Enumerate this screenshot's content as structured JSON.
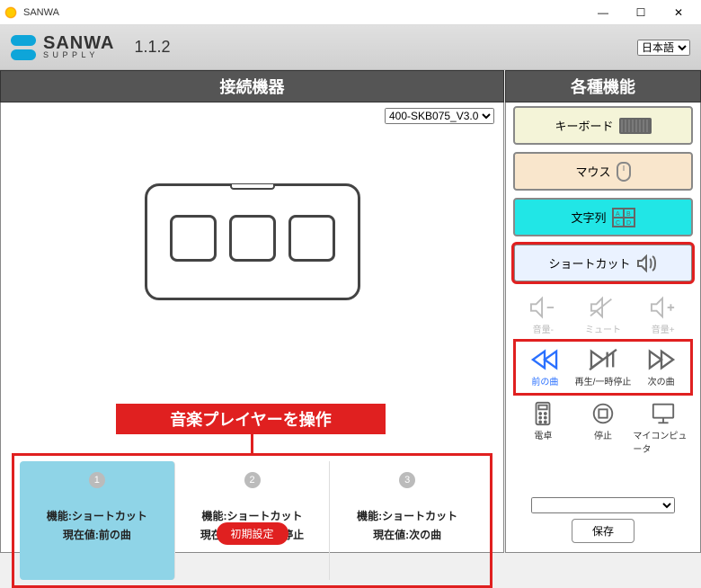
{
  "window": {
    "title": "SANWA"
  },
  "header": {
    "brand": "SANWA",
    "sub": "SUPPLY",
    "version": "1.1.2",
    "lang_selected": "日本語"
  },
  "sections": {
    "left": "接続機器",
    "right": "各種機能"
  },
  "device_select": {
    "selected": "400-SKB075_V3.0"
  },
  "annotation": "音楽プレイヤーを操作",
  "slots": [
    {
      "num": "1",
      "fn": "機能:ショートカット",
      "cv": "現在値:前の曲",
      "selected": true
    },
    {
      "num": "2",
      "fn": "機能:ショートカット",
      "cv": "現在値:再生/一時停止",
      "selected": false
    },
    {
      "num": "3",
      "fn": "機能:ショートカット",
      "cv": "現在値:次の曲",
      "selected": false
    }
  ],
  "reset": "初期設定",
  "categories": {
    "keyboard": "キーボード",
    "mouse": "マウス",
    "string": "文字列",
    "shortcut": "ショートカット"
  },
  "shortcuts": {
    "vol_down": "音量-",
    "mute": "ミュート",
    "vol_up": "音量+",
    "prev": "前の曲",
    "play": "再生/一時停止",
    "next": "次の曲",
    "calc": "電卓",
    "stop": "停止",
    "computer": "マイコンピュータ"
  },
  "save": "保存"
}
